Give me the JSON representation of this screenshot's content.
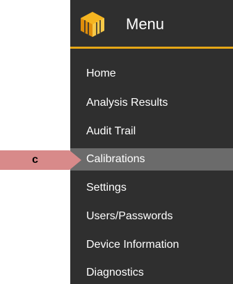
{
  "menu": {
    "title": "Menu",
    "logo_icon": "cube-logo-icon",
    "accent_color": "#e6a817",
    "items": [
      {
        "label": "Home"
      },
      {
        "label": "Analysis Results"
      },
      {
        "label": "Audit Trail"
      },
      {
        "label": "Calibrations",
        "active": true
      },
      {
        "label": "Settings"
      },
      {
        "label": "Users/Passwords"
      },
      {
        "label": "Device Information"
      },
      {
        "label": "Diagnostics"
      }
    ]
  },
  "callout": {
    "label": "c",
    "color": "#d88a8a"
  }
}
